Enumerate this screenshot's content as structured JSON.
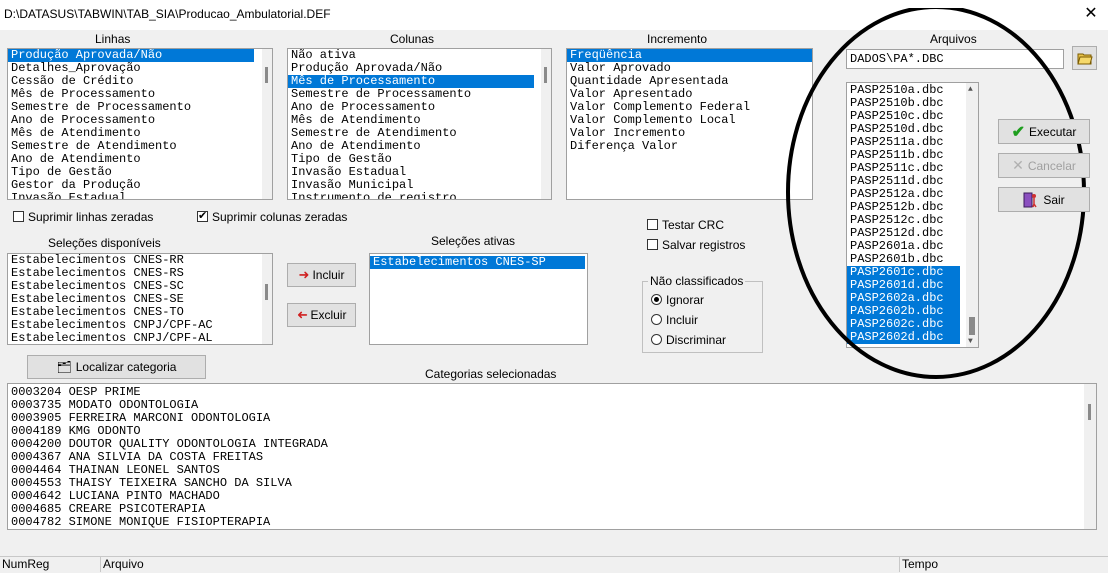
{
  "window": {
    "title": "D:\\DATASUS\\TABWIN\\TAB_SIA\\Producao_Ambulatorial.DEF",
    "close_label": "✕"
  },
  "linhas": {
    "label": "Linhas",
    "items": [
      "Produção Aprovada/Não",
      "Detalhes_Aprovação",
      "Cessão de Crédito",
      "Mês de Processamento",
      "Semestre de Processamento",
      "Ano de Processamento",
      "Mês de Atendimento",
      "Semestre de Atendimento",
      "Ano de Atendimento",
      "Tipo de Gestão",
      "Gestor da Produção",
      "Invasão Estadual"
    ],
    "selected_index": 0
  },
  "colunas": {
    "label": "Colunas",
    "items": [
      "Não ativa",
      "Produção Aprovada/Não",
      "Mês de Processamento",
      "Semestre de Processamento",
      "Ano de Processamento",
      "Mês de Atendimento",
      "Semestre de Atendimento",
      "Ano de Atendimento",
      "Tipo de Gestão",
      "Invasão Estadual",
      "Invasão Municipal",
      "Instrumento de registro"
    ],
    "selected_index": 2
  },
  "incremento": {
    "label": "Incremento",
    "items": [
      "Freqüência",
      "Valor Aprovado",
      "Quantidade Apresentada",
      "Valor Apresentado",
      "Valor Complemento Federal",
      "Valor Complemento Local",
      "Valor Incremento",
      "Diferença Valor"
    ],
    "selected_index": 0
  },
  "arquivos": {
    "label": "Arquivos",
    "pattern": "DADOS\\PA*.DBC",
    "items": [
      "PASP2510a.dbc",
      "PASP2510b.dbc",
      "PASP2510c.dbc",
      "PASP2510d.dbc",
      "PASP2511a.dbc",
      "PASP2511b.dbc",
      "PASP2511c.dbc",
      "PASP2511d.dbc",
      "PASP2512a.dbc",
      "PASP2512b.dbc",
      "PASP2512c.dbc",
      "PASP2512d.dbc",
      "PASP2601a.dbc",
      "PASP2601b.dbc",
      "PASP2601c.dbc",
      "PASP2601d.dbc",
      "PASP2602a.dbc",
      "PASP2602b.dbc",
      "PASP2602c.dbc",
      "PASP2602d.dbc"
    ],
    "selected_from": 14
  },
  "buttons": {
    "executar": "Executar",
    "cancelar": "Cancelar",
    "sair": "Sair",
    "incluir": "Incluir",
    "excluir": "Excluir",
    "localizar": "Localizar categoria"
  },
  "checks": {
    "suprimir_linhas": "Suprimir linhas zeradas",
    "suprimir_colunas": "Suprimir colunas zeradas",
    "testar_crc": "Testar CRC",
    "salvar_registros": "Salvar registros"
  },
  "nao_classificados": {
    "label": "Não classificados",
    "options": [
      "Ignorar",
      "Incluir",
      "Discriminar"
    ],
    "selected": 0
  },
  "selecoes_disponiveis": {
    "label": "Seleções disponíveis",
    "items": [
      "Estabelecimentos CNES-RR",
      "Estabelecimentos CNES-RS",
      "Estabelecimentos CNES-SC",
      "Estabelecimentos CNES-SE",
      "Estabelecimentos CNES-TO",
      "Estabelecimentos CNPJ/CPF-AC",
      "Estabelecimentos CNPJ/CPF-AL"
    ]
  },
  "selecoes_ativas": {
    "label": "Seleções ativas",
    "items": [
      "Estabelecimentos CNES-SP"
    ]
  },
  "categorias": {
    "label": "Categorias selecionadas",
    "items": [
      "0003204 OESP PRIME",
      "0003735 MODATO ODONTOLOGIA",
      "0003905 FERREIRA MARCONI ODONTOLOGIA",
      "0004189 KMG ODONTO",
      "0004200 DOUTOR QUALITY ODONTOLOGIA INTEGRADA",
      "0004367 ANA SILVIA DA COSTA FREITAS",
      "0004464 THAINAN LEONEL SANTOS",
      "0004553 THAISY TEIXEIRA SANCHO DA SILVA",
      "0004642 LUCIANA PINTO MACHADO",
      "0004685 CREARE PSICOTERAPIA",
      "0004782 SIMONE MONIQUE FISIOPTERAPIA"
    ]
  },
  "status": {
    "numreg": "NumReg",
    "arquivo": "Arquivo",
    "tempo": "Tempo"
  }
}
